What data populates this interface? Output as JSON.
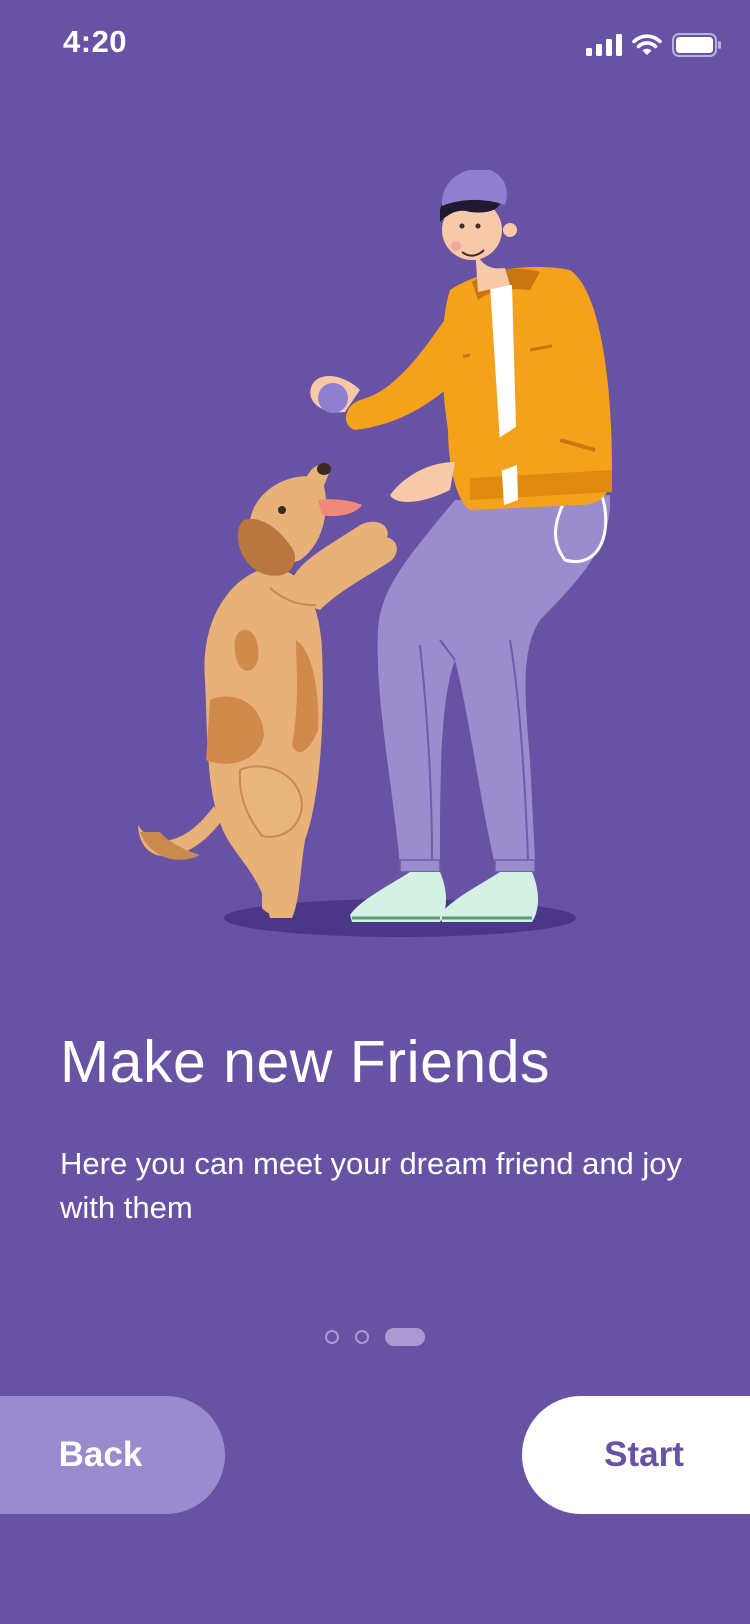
{
  "status_bar": {
    "time": "4:20",
    "icons": [
      "cellular-signal-icon",
      "wifi-icon",
      "battery-icon"
    ]
  },
  "illustration": {
    "name": "man-playing-with-dog",
    "colors": {
      "jacket": "#f4a21b",
      "pants": "#9b8ccd",
      "dog": "#e7b177",
      "shoes": "#d4f1e4"
    }
  },
  "onboarding": {
    "title": "Make new Friends",
    "subtitle": "Here you can meet your dream friend and joy with them",
    "page_indicator": {
      "current": 3,
      "total": 3
    }
  },
  "buttons": {
    "back_label": "Back",
    "start_label": "Start"
  },
  "colors": {
    "background": "#6752a4",
    "back_button": "#9a8bce",
    "start_button": "#ffffff",
    "start_text": "#6752a4"
  }
}
